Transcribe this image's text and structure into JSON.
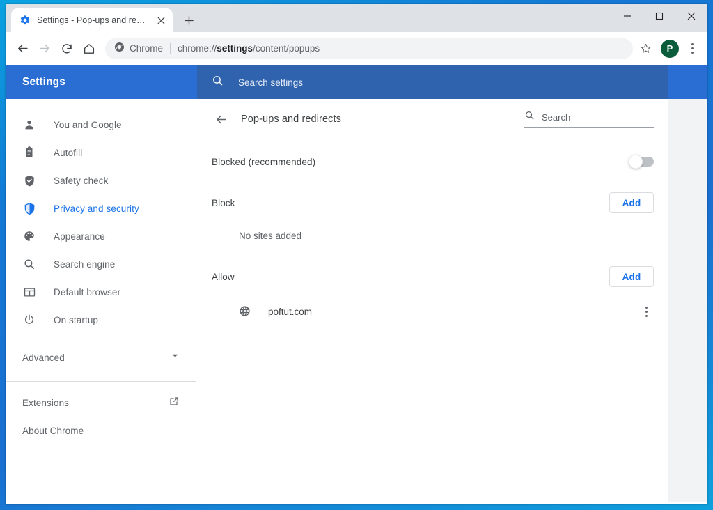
{
  "window": {
    "minimize_label": "Minimize",
    "maximize_label": "Maximize",
    "close_label": "Close"
  },
  "tabstrip": {
    "tabs": [
      {
        "title": "Settings - Pop-ups and redirects",
        "favicon": "gear-icon",
        "close_label": "Close tab"
      }
    ],
    "new_tab_label": "New tab"
  },
  "toolbar": {
    "back_label": "Back",
    "forward_label": "Forward",
    "reload_label": "Reload",
    "home_label": "Home",
    "omnibox": {
      "badge_icon": "chrome-icon",
      "badge_label": "Chrome",
      "url_prefix": "chrome://",
      "url_bold": "settings",
      "url_suffix": "/content/popups",
      "full_url": "chrome://settings/content/popups"
    },
    "bookmark_label": "Bookmark this tab",
    "profile_initial": "P",
    "menu_label": "Customize and control Google Chrome"
  },
  "settings_header": {
    "brand": "Settings",
    "search_icon": "search-icon",
    "search_placeholder": "Search settings",
    "bar_color": "#2a6ed3",
    "search_color": "#2f63ad"
  },
  "sidebar": {
    "items": [
      {
        "label": "You and Google",
        "icon": "person-icon",
        "active": false
      },
      {
        "label": "Autofill",
        "icon": "clipboard-icon",
        "active": false
      },
      {
        "label": "Safety check",
        "icon": "shield-check-icon",
        "active": false
      },
      {
        "label": "Privacy and security",
        "icon": "shield-icon",
        "active": true
      },
      {
        "label": "Appearance",
        "icon": "palette-icon",
        "active": false
      },
      {
        "label": "Search engine",
        "icon": "search-icon",
        "active": false
      },
      {
        "label": "Default browser",
        "icon": "browser-window-icon",
        "active": false
      },
      {
        "label": "On startup",
        "icon": "power-icon",
        "active": false
      }
    ],
    "advanced": {
      "label": "Advanced",
      "icon": "chevron-down-icon"
    },
    "footer_items": [
      {
        "label": "Extensions",
        "icon": "external-link-icon"
      },
      {
        "label": "About Chrome",
        "icon": null
      }
    ],
    "active_color": "#1a73e8"
  },
  "page": {
    "back_icon": "arrow-left-icon",
    "title": "Pop-ups and redirects",
    "search_icon": "search-icon",
    "search_placeholder": "Search",
    "toggle_setting": {
      "label": "Blocked (recommended)",
      "state": "off"
    },
    "sections": [
      {
        "heading": "Block",
        "add_label": "Add",
        "empty_text": "No sites added",
        "sites": []
      },
      {
        "heading": "Allow",
        "add_label": "Add",
        "empty_text": null,
        "sites": [
          {
            "name": "poftut.com",
            "icon": "globe-icon",
            "menu_label": "More actions"
          }
        ]
      }
    ]
  }
}
